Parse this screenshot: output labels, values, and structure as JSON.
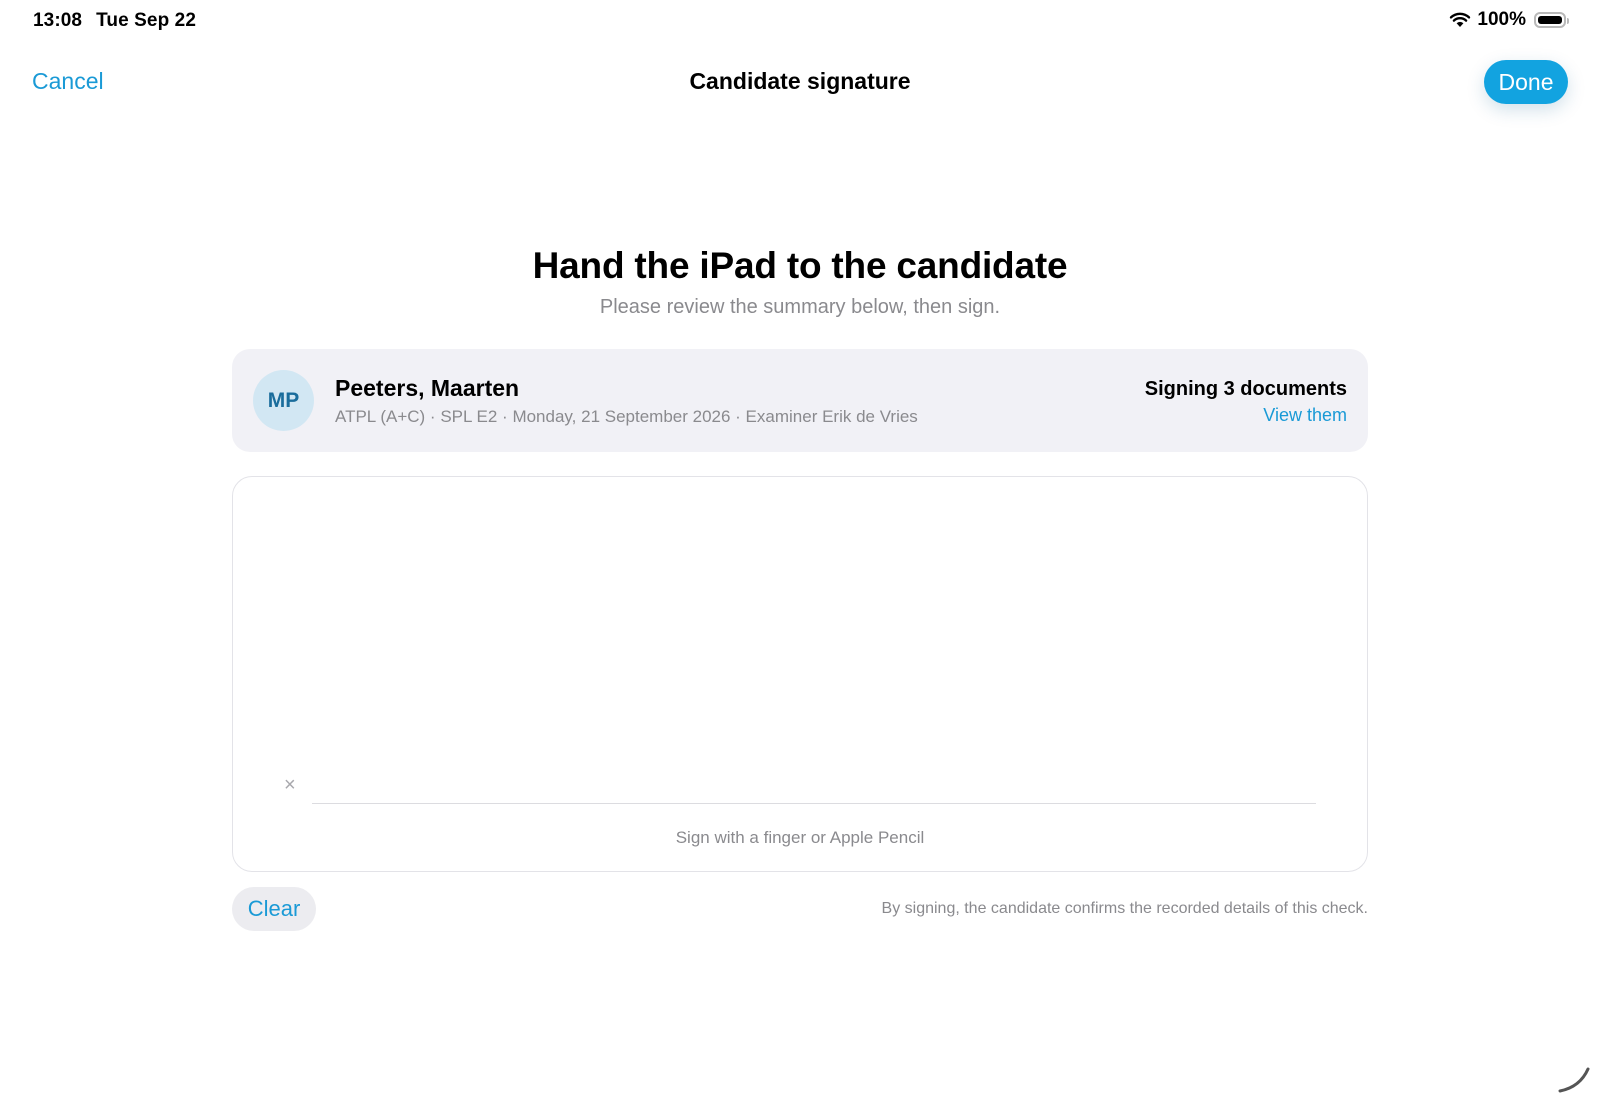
{
  "status_bar": {
    "time": "13:08",
    "date": "Tue Sep 22",
    "battery_text": "100%",
    "icons": [
      "wifi-icon",
      "battery-icon"
    ]
  },
  "nav": {
    "cancel_label": "Cancel",
    "title": "Candidate signature",
    "done_label": "Done"
  },
  "heading": {
    "title": "Hand the iPad to the candidate",
    "subtitle": "Please review the summary below, then sign."
  },
  "summary": {
    "initials": "MP",
    "name": "Peeters, Maarten",
    "details": "ATPL (A+C) · SPL E2 · Monday, 21 September 2026 · Examiner Erik de Vries",
    "signing_count": "Signing 3 documents",
    "view_link": "View them"
  },
  "signature_pad": {
    "x_mark": "×",
    "hint": "Sign with a finger or Apple Pencil"
  },
  "footer": {
    "clear_label": "Clear",
    "disclaimer": "By signing, the candidate confirms the recorded details of this check."
  },
  "colors": {
    "accent": "#12a3e0",
    "link": "#1a9ad6",
    "card_background": "#f1f1f6",
    "avatar_background": "#d2e7f3",
    "secondary_text": "#8a8a8e"
  }
}
